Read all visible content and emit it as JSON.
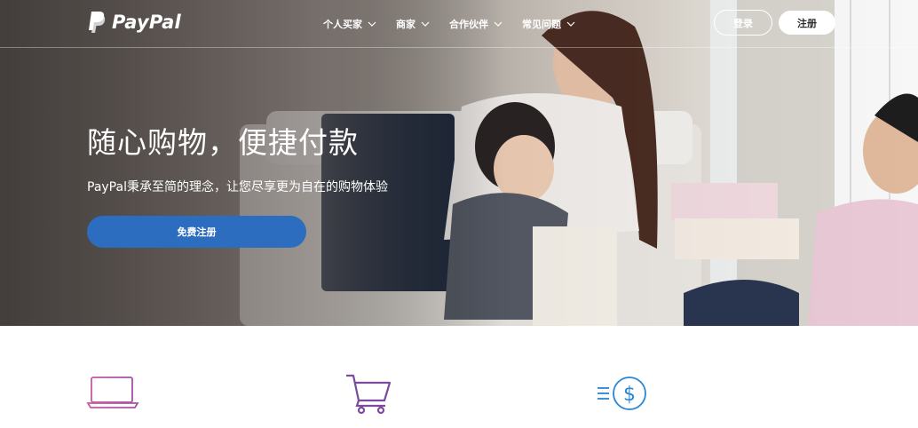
{
  "brand": {
    "name": "PayPal"
  },
  "nav": {
    "items": [
      {
        "label": "个人买家"
      },
      {
        "label": "商家"
      },
      {
        "label": "合作伙伴"
      },
      {
        "label": "常见问题"
      }
    ],
    "login_label": "登录",
    "signup_label": "注册"
  },
  "hero": {
    "headline": "随心购物，便捷付款",
    "subline": "PayPal秉承至简的理念，让您尽享更为自在的购物体验",
    "cta_label": "免费注册"
  },
  "features": {
    "icons": [
      "laptop-icon",
      "shopping-cart-icon",
      "fast-payment-dollar-icon"
    ]
  },
  "colors": {
    "cta": "#2c6dbf",
    "icon_purple_pink": "#c052a0",
    "icon_purple": "#7b4b9e",
    "icon_blue": "#2a86d4"
  }
}
